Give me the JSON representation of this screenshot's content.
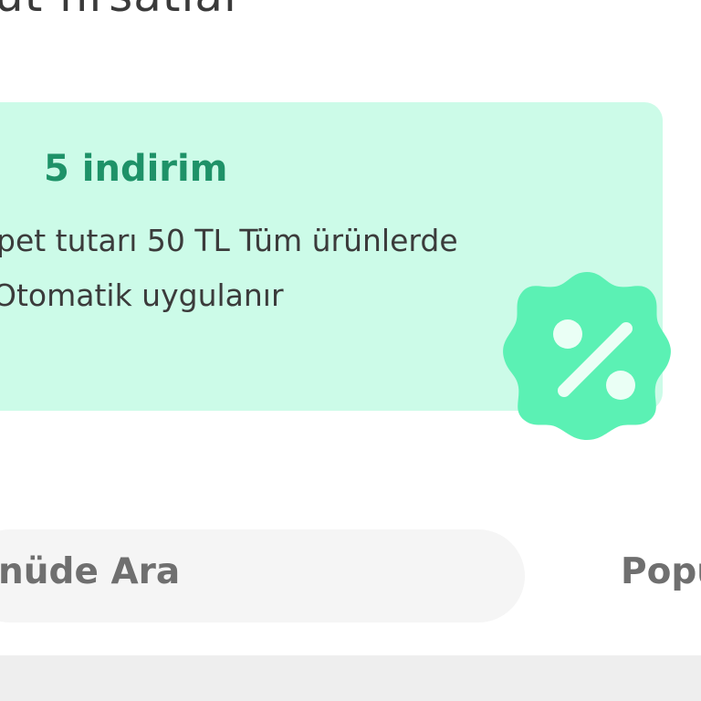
{
  "section": {
    "title": "ut fırsatlar"
  },
  "promo": {
    "title": "5 indirim",
    "line1": "pet tutarı 50 TL Tüm ürünlerde",
    "line2": "Otomatik uygulanır",
    "background_color": "#ccfbe8",
    "title_color": "#1e9268",
    "badge_color": "#5bf1b4",
    "badge_icon": "percent-icon"
  },
  "search": {
    "placeholder": "nüde Ara"
  },
  "sort": {
    "label": "Popu"
  }
}
